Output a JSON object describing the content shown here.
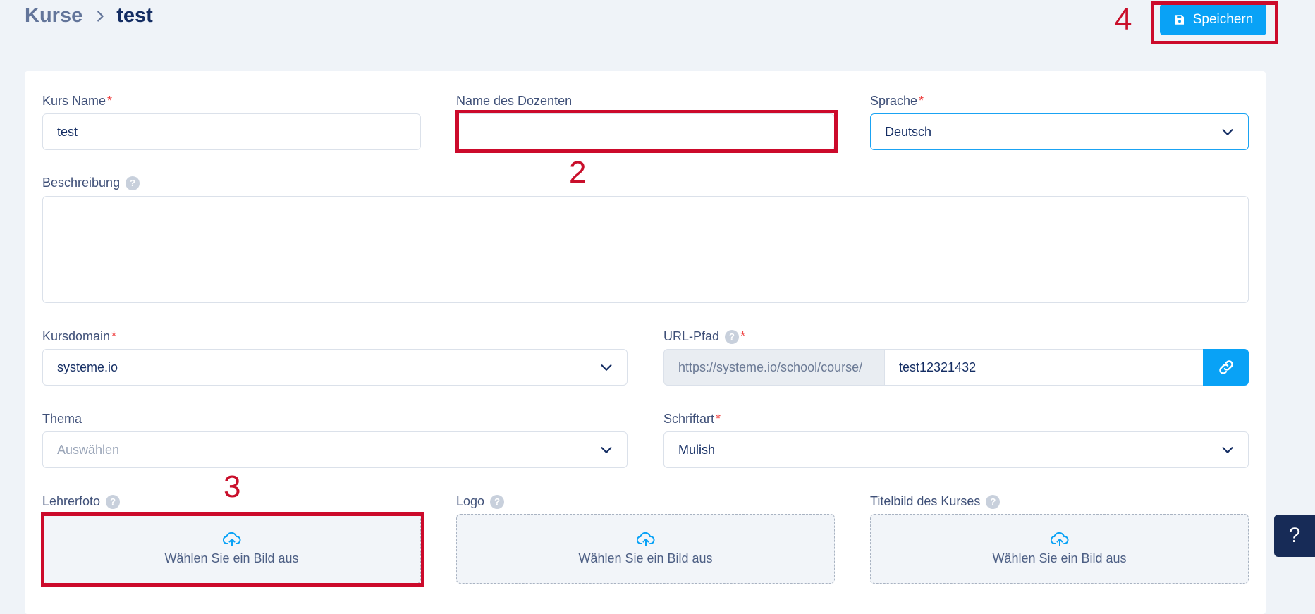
{
  "breadcrumb": {
    "parent": "Kurse",
    "current": "test"
  },
  "toolbar": {
    "save_label": "Speichern"
  },
  "form": {
    "course_name": {
      "label": "Kurs Name",
      "required": "*",
      "value": "test"
    },
    "instructor_name": {
      "label": "Name des Dozenten",
      "value": ""
    },
    "language": {
      "label": "Sprache",
      "required": "*",
      "value": "Deutsch"
    },
    "description": {
      "label": "Beschreibung",
      "help": "?"
    },
    "course_domain": {
      "label": "Kursdomain",
      "required": "*",
      "value": "systeme.io"
    },
    "url_path": {
      "label": "URL-Pfad",
      "help": "?",
      "required": "*",
      "prefix": "https://systeme.io/school/course/",
      "value": "test12321432"
    },
    "theme": {
      "label": "Thema",
      "placeholder": "Auswählen"
    },
    "font": {
      "label": "Schriftart",
      "required": "*",
      "value": "Mulish"
    },
    "teacher_photo": {
      "label": "Lehrerfoto",
      "help": "?",
      "button": "Wählen Sie ein Bild aus"
    },
    "logo": {
      "label": "Logo",
      "help": "?",
      "button": "Wählen Sie ein Bild aus"
    },
    "cover_image": {
      "label": "Titelbild des Kurses",
      "help": "?",
      "button": "Wählen Sie ein Bild aus"
    }
  },
  "annotations": {
    "n2": "2",
    "n3": "3",
    "n4": "4"
  },
  "help_widget": {
    "label": "?"
  },
  "colors": {
    "accent": "#09a2f6",
    "annotation": "#cc0a2b",
    "text": "#142d63"
  }
}
